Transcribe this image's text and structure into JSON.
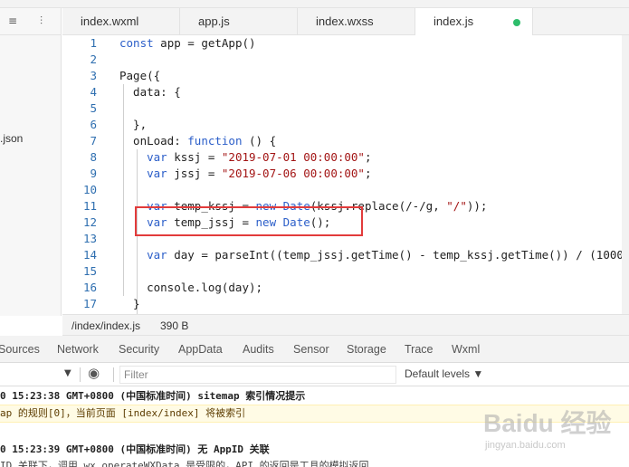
{
  "sidebar": {
    "file_label": ".json",
    "tool_icons": [
      "≡",
      "⫶"
    ]
  },
  "tabs": [
    {
      "label": "index.wxml"
    },
    {
      "label": "app.js"
    },
    {
      "label": "index.wxss"
    },
    {
      "label": "index.js"
    }
  ],
  "editor": {
    "line_numbers": [
      "1",
      "2",
      "3",
      "4",
      "5",
      "6",
      "7",
      "8",
      "9",
      "10",
      "11",
      "12",
      "13",
      "14",
      "15",
      "16",
      "17"
    ]
  },
  "status": {
    "path": "/index/index.js",
    "size": "390 B"
  },
  "devtools": {
    "tabs": [
      "Sources",
      "Network",
      "Security",
      "AppData",
      "Audits",
      "Sensor",
      "Storage",
      "Trace",
      "Wxml"
    ],
    "filter_placeholder": "Filter",
    "levels_label": "Default levels ▼"
  },
  "console": {
    "messages": [
      "0 15:23:38 GMT+0800 (中国标准时间) sitemap 索引情况提示",
      "ap 的规则[0]，当前页面 [index/index] 将被索引",
      "0 15:23:39 GMT+0800 (中国标准时间) 无 AppID 关联",
      "ID 关联下，调用 wx.operateWXData 是受限的，API 的返回是工具的模拟返回"
    ]
  },
  "watermark": {
    "text": "Baidu 经验",
    "sub": "jingyan.baidu.com"
  },
  "colors": {
    "keyword": "#2b5ec9",
    "string": "#a31515",
    "highlight": "#e23b3b",
    "modified_dot": "#2ebd6b"
  }
}
